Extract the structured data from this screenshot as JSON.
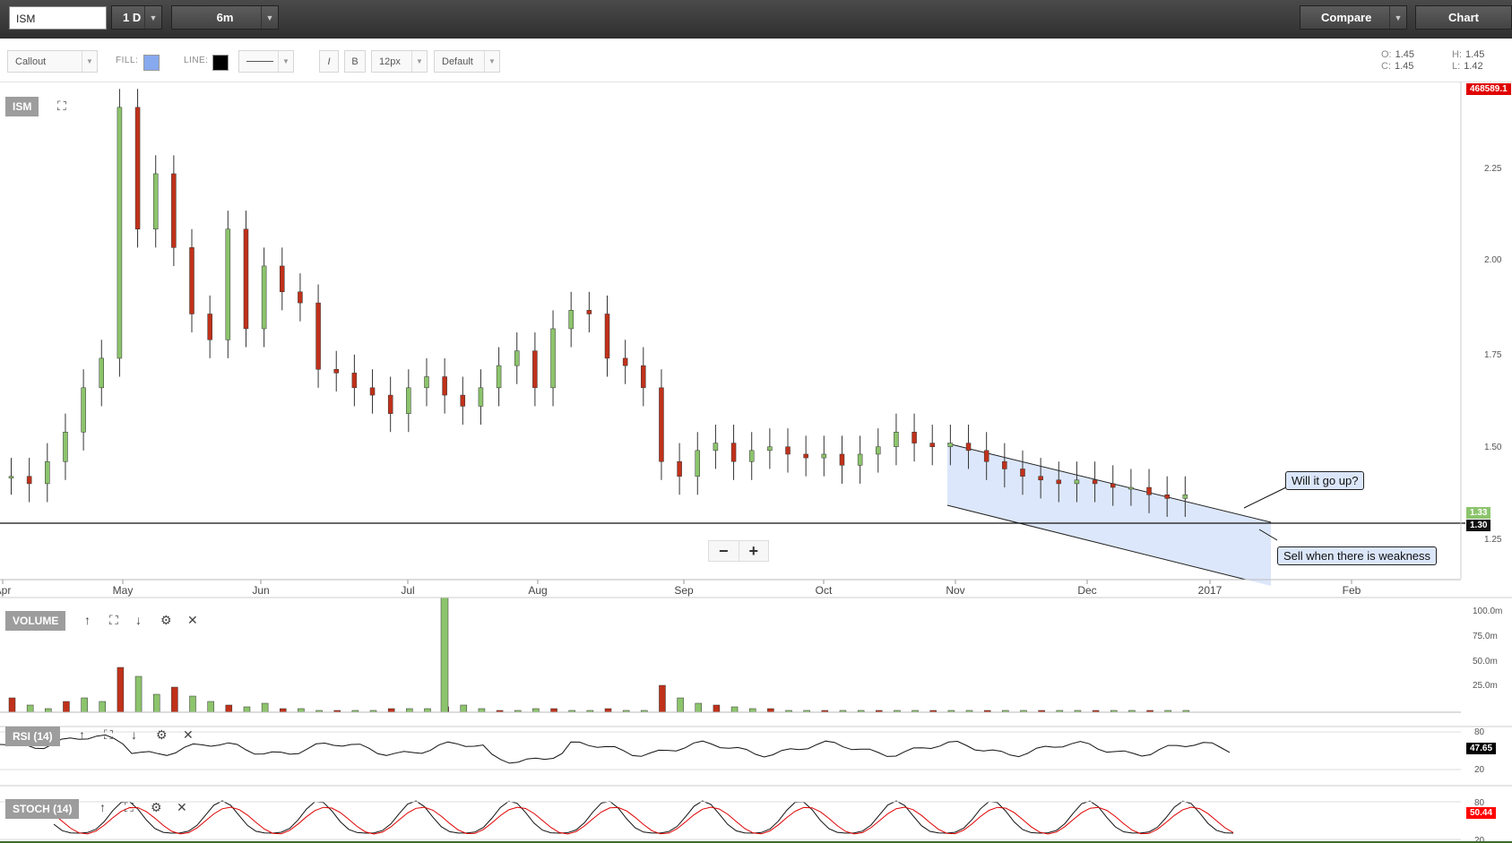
{
  "topbar": {
    "symbol": "ISM",
    "interval": "1 D",
    "range": "6m",
    "compare": "Compare",
    "chart": "Chart"
  },
  "toolbar": {
    "annotation_type": "Callout",
    "fill_label": "FILL:",
    "fill_color": "#87a9ee",
    "line_label": "LINE:",
    "line_color": "#000000",
    "italic": "I",
    "bold": "B",
    "font_size": "12px",
    "font_family": "Default"
  },
  "ohlc": {
    "o_label": "O:",
    "o": "1.45",
    "c_label": "C:",
    "c": "1.45",
    "h_label": "H:",
    "h": "1.45",
    "l_label": "L:",
    "l": "1.42"
  },
  "main_pane": {
    "label": "ISM",
    "top_tag": "468589.1",
    "current_tag": "1.33",
    "line_tag": "1.30",
    "y_ticks": [
      "2.25",
      "2.00",
      "1.75",
      "1.50",
      "1.25"
    ],
    "x_ticks": [
      "Apr",
      "May",
      "Jun",
      "Jul",
      "Aug",
      "Sep",
      "Oct",
      "Nov",
      "Dec",
      "2017",
      "Feb"
    ],
    "callout_up": "Will it go up?",
    "callout_sell": "Sell when there is weakness",
    "zoom_out": "−",
    "zoom_in": "+"
  },
  "volume_pane": {
    "label": "VOLUME",
    "y_ticks": [
      "100.0m",
      "75.0m",
      "50.0m",
      "25.0m"
    ]
  },
  "rsi_pane": {
    "label": "RSI (14)",
    "y_ticks": [
      "80",
      "20"
    ],
    "value_tag": "47.65"
  },
  "stoch_pane": {
    "label": "STOCH (14)",
    "y_ticks": [
      "80",
      "20"
    ],
    "value_tag": "50.44"
  },
  "colors": {
    "up": "#8cc46c",
    "down": "#c0311a",
    "channel": "#dce7fb",
    "rsi_tag": "#000000",
    "stoch_tag": "#ff0000"
  },
  "chart_data": {
    "type": "candlestick",
    "title": "ISM",
    "y_range": [
      1.1,
      2.45
    ],
    "note": "approximate daily price (close) trend",
    "closes": [
      1.38,
      1.36,
      1.42,
      1.5,
      1.62,
      1.7,
      2.38,
      2.05,
      2.2,
      2.0,
      1.82,
      1.75,
      2.05,
      1.78,
      1.95,
      1.88,
      1.85,
      1.67,
      1.66,
      1.62,
      1.6,
      1.55,
      1.62,
      1.65,
      1.6,
      1.57,
      1.62,
      1.68,
      1.72,
      1.62,
      1.78,
      1.83,
      1.82,
      1.7,
      1.68,
      1.62,
      1.42,
      1.38,
      1.45,
      1.47,
      1.42,
      1.45,
      1.46,
      1.44,
      1.43,
      1.44,
      1.41,
      1.44,
      1.46,
      1.5,
      1.47,
      1.46,
      1.47,
      1.45,
      1.42,
      1.4,
      1.38,
      1.37,
      1.36,
      1.37,
      1.36,
      1.35,
      1.35,
      1.33,
      1.32,
      1.33
    ]
  }
}
